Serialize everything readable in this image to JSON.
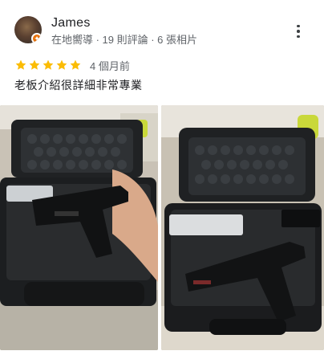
{
  "review": {
    "author": {
      "name": "James",
      "meta": "在地嚮導 · 19 則評論 · 6 張相片"
    },
    "rating": 5,
    "time": "4 個月前",
    "text": "老板介紹很詳細非常專業",
    "photos": [
      {
        "name": "review-photo-1"
      },
      {
        "name": "review-photo-2"
      }
    ]
  },
  "icons": {
    "more": "more-vert-icon",
    "star": "star-icon",
    "local_guide_badge": "local-guide-badge-icon"
  },
  "colors": {
    "star": "#fbbc04",
    "meta_text": "#5f6368",
    "primary_text": "#202124",
    "local_guide_badge": "#e8710a"
  }
}
